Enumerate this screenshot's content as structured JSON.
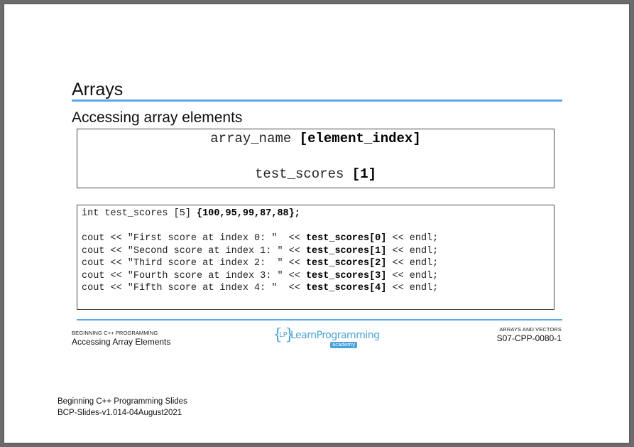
{
  "slide": {
    "title": "Arrays",
    "subtitle": "Accessing array elements",
    "syntax": {
      "line1_plain": "array_name ",
      "line1_bold": "[element_index]",
      "line2_plain": "test_scores ",
      "line2_bold": "[1]"
    },
    "code": {
      "declaration_plain": "int test_scores [5] ",
      "declaration_bold": "{100,95,99,87,88};",
      "lines": [
        {
          "pre": "cout << \"First score at index 0: \"  << ",
          "bold": "test_scores[0]",
          "post": " << endl;"
        },
        {
          "pre": "cout << \"Second score at index 1: \" << ",
          "bold": "test_scores[1]",
          "post": " << endl;"
        },
        {
          "pre": "cout << \"Third score at index 2:  \" << ",
          "bold": "test_scores[2]",
          "post": " << endl;"
        },
        {
          "pre": "cout << \"Fourth score at index 3: \" << ",
          "bold": "test_scores[3]",
          "post": " << endl;"
        },
        {
          "pre": "cout << \"Fifth score at index 4: \"  << ",
          "bold": "test_scores[4]",
          "post": " << endl;"
        }
      ]
    },
    "footer": {
      "left_small": "BEGINNING C++ PROGRAMMING",
      "left_main": "Accessing Array Elements",
      "logo_lp": "LP",
      "logo_text": "LearnProgramming",
      "logo_academy": "academy",
      "right_small": "ARRAYS AND VECTORS",
      "right_main": "S07-CPP-0080-1"
    }
  },
  "document": {
    "line1": "Beginning C++ Programming Slides",
    "line2": "BCP-Slides-v1.014-04August2021"
  },
  "colors": {
    "accent": "#5aa9ea",
    "background": "#6b6b6b"
  }
}
